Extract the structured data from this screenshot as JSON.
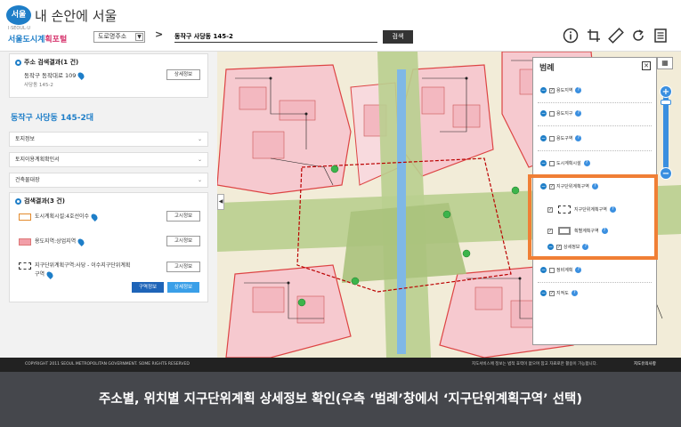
{
  "header": {
    "logo_mark": "서울",
    "slogan": "내 손안에 서울",
    "logo_sub1": "I·SEOUL·U",
    "logo_sub2a": "서울도시계",
    "logo_sub2b": "획포털",
    "select_value": "도로명주소",
    "select_caret": "▼",
    "chevron": ">",
    "search_value": "동작구 사당동 145-2",
    "search_button": "검색"
  },
  "left": {
    "address_title": "주소 검색결과(1 건)",
    "address_line1": "동작구 동작대로 109",
    "address_line2": "사당동 145-2",
    "detail_button": "상세정보",
    "lot_title": "동작구 사당동 145-2대",
    "accordions": [
      {
        "label": "토지정보",
        "caret": "⌄"
      },
      {
        "label": "토지이용계획확인서",
        "caret": "⌄"
      },
      {
        "label": "건축물대장",
        "caret": "⌄"
      }
    ],
    "result_title": "검색결과(3 건)",
    "results": [
      {
        "label": "도시계획시설:4호선이수",
        "button": "고시정보"
      },
      {
        "label": "용도지역:상업지역",
        "button": "고시정보"
      },
      {
        "label": "지구단위계획구역:사당 - 이수지구단위계획",
        "label2": "구역",
        "button": "고시정보"
      }
    ],
    "zone_info_button": "구역정보",
    "detail_info_button": "상세정보",
    "collapse_arrow": "◀"
  },
  "legend": {
    "title": "범례",
    "close": "✕",
    "items": [
      {
        "label": "용도지역",
        "checked": true
      },
      {
        "label": "용도지구",
        "checked": false
      },
      {
        "label": "용도구역",
        "checked": false
      },
      {
        "label": "도시계획시설",
        "checked": false
      },
      {
        "label": "지구단위계획구역",
        "checked": true
      },
      {
        "label": "지구단위계획구역",
        "checked": true
      },
      {
        "label": "획별계획구역",
        "checked": true
      },
      {
        "label": "상세정보",
        "checked": true
      },
      {
        "label": "정비계획",
        "checked": false
      },
      {
        "label": "지적도",
        "checked": true
      }
    ],
    "minus": "−",
    "check": "✓",
    "help": "?"
  },
  "zoom": {
    "plus": "+",
    "minus": "−",
    "layers": "▦"
  },
  "footer": {
    "copyright": "COPYRIGHT 2011 SEOUL METROPOLITAN GOVERNMENT. SOME RIGHTS RESERVED",
    "notice": "지도서비스에 정보는 법적 효력이 없으며 참고 자료로만 활용이 가능합니다.",
    "sitemap": "지도유의사항"
  },
  "caption": "주소별, 위치별 지구단위계획 상세정보 확인(우측 ‘범례’창에서 ‘지구단위계획구역’ 선택)",
  "colors": {
    "accent": "#1e7ec8",
    "highlight": "#f07f35",
    "caption_bg": "#45474c"
  }
}
